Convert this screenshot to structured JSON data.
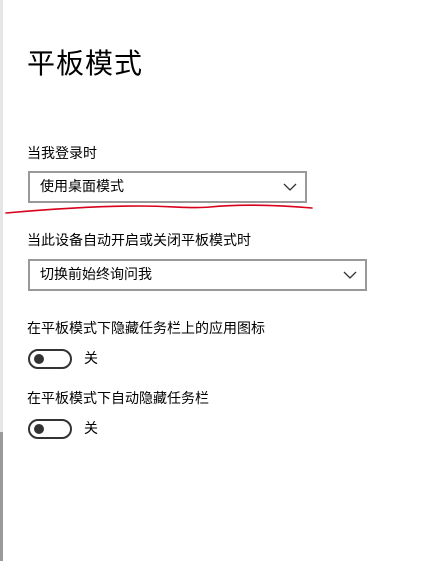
{
  "page": {
    "title": "平板模式"
  },
  "signin": {
    "label": "当我登录时",
    "selected": "使用桌面模式"
  },
  "auto_switch": {
    "label": "当此设备自动开启或关闭平板模式时",
    "selected": "切换前始终询问我"
  },
  "hide_app_icons": {
    "label": "在平板模式下隐藏任务栏上的应用图标",
    "state_label": "关"
  },
  "auto_hide_taskbar": {
    "label": "在平板模式下自动隐藏任务栏",
    "state_label": "关"
  },
  "icons": {
    "dropdown": "chevron-down-icon",
    "annotation": "red-underline-mark"
  },
  "colors": {
    "annotation": "#d9001b",
    "toggle_off": "#333333",
    "select_border": "#999999"
  }
}
